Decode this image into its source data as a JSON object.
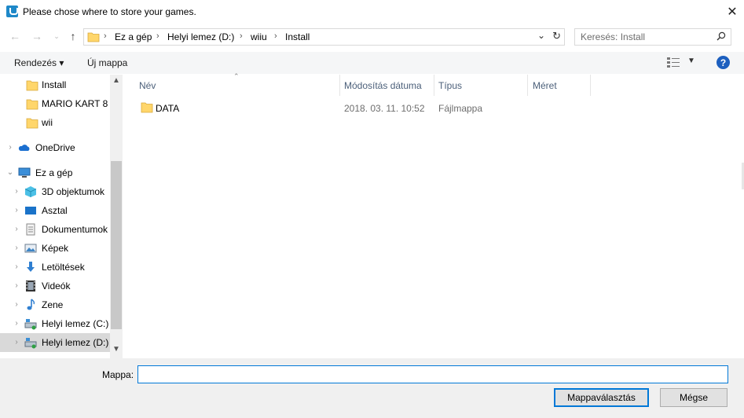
{
  "window": {
    "title": "Please chose where to store your games.",
    "close_label": "✕"
  },
  "address": {
    "crumbs": [
      "Ez a gép",
      "Helyi lemez (D:)",
      "wiiu",
      "Install"
    ],
    "search_placeholder": "Keresés: Install"
  },
  "toolbar": {
    "organize_label": "Rendezés ▾",
    "new_folder_label": "Új mappa",
    "help_label": "?"
  },
  "nav": {
    "items": [
      {
        "label": "Install",
        "icon": "folder-icon"
      },
      {
        "label": "MARIO KART 8 [",
        "icon": "folder-icon"
      },
      {
        "label": "wii",
        "icon": "folder-icon"
      },
      {
        "label": "OneDrive",
        "icon": "cloud-icon"
      },
      {
        "label": "Ez a gép",
        "icon": "computer-icon"
      },
      {
        "label": "3D objektumok",
        "icon": "cube-icon"
      },
      {
        "label": "Asztal",
        "icon": "desktop-icon"
      },
      {
        "label": "Dokumentumok",
        "icon": "document-icon"
      },
      {
        "label": "Képek",
        "icon": "pictures-icon"
      },
      {
        "label": "Letöltések",
        "icon": "download-icon"
      },
      {
        "label": "Videók",
        "icon": "video-icon"
      },
      {
        "label": "Zene",
        "icon": "music-icon"
      },
      {
        "label": "Helyi lemez (C:)",
        "icon": "drive-icon"
      },
      {
        "label": "Helyi lemez (D:)",
        "icon": "drive-icon"
      }
    ],
    "selected": "Helyi lemez (D:)"
  },
  "columns": {
    "name": "Név",
    "modified": "Módosítás dátuma",
    "type": "Típus",
    "size": "Méret"
  },
  "files": [
    {
      "name": "DATA",
      "modified": "2018. 03. 11. 10:52",
      "type": "Fájlmappa",
      "size": ""
    }
  ],
  "bottom": {
    "folder_label": "Mappa:",
    "folder_value": "",
    "select_button": "Mappaválasztás",
    "cancel_button": "Mégse"
  },
  "colors": {
    "accent": "#0078d7",
    "folder": "#ffd66b",
    "help": "#1c5fbf"
  }
}
